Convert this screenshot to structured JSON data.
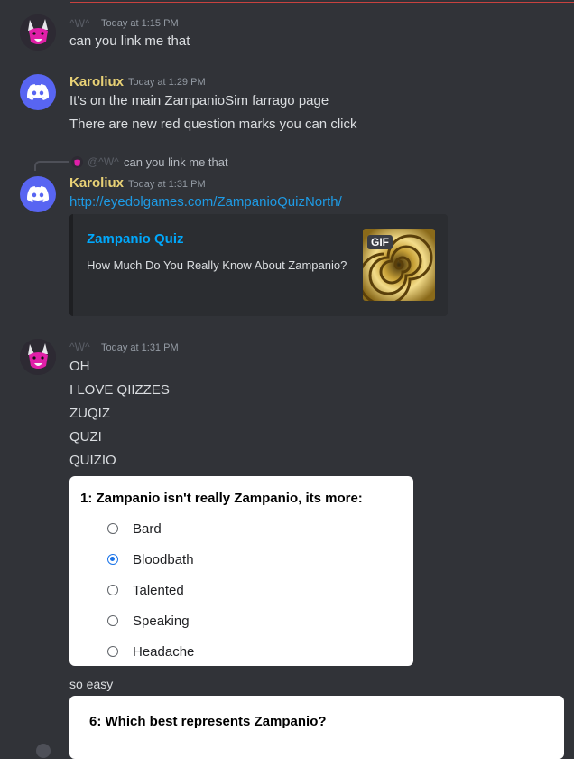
{
  "messages": [
    {
      "author": "^W^",
      "timestamp": "Today at 1:15 PM",
      "lines": [
        "can you link me that"
      ]
    },
    {
      "author": "Karoliux",
      "timestamp": "Today at 1:29 PM",
      "lines": [
        "It's on the main ZampanioSim farrago page",
        "There are new red question marks you can click"
      ]
    },
    {
      "reply": {
        "author": "@^W^",
        "text": "can you link me that"
      },
      "author": "Karoliux",
      "timestamp": "Today at 1:31 PM",
      "link": "http://eyedolgames.com/ZampanioQuizNorth/",
      "embed": {
        "title": "Zampanio Quiz",
        "description": "How Much Do You Really Know About Zampanio?",
        "badge": "GIF"
      }
    },
    {
      "author": "^W^",
      "timestamp": "Today at 1:31 PM",
      "lines": [
        "OH",
        "I LOVE QIIZZES",
        "ZUQIZ",
        "QUZI",
        "QUIZIO"
      ],
      "quiz": {
        "question": "1: Zampanio isn't really Zampanio, its more:",
        "options": [
          "Bard",
          "Bloodbath",
          "Talented",
          "Speaking",
          "Headache"
        ],
        "selected": "Bloodbath"
      },
      "after": "so easy",
      "quiz2": {
        "question": "6: Which best represents Zampanio?"
      }
    }
  ],
  "icons": {
    "discord": "discord-logo-icon",
    "fox": "fox-avatar-icon"
  },
  "colors": {
    "background": "#313338",
    "author_highlight": "#e8d176",
    "link": "#1e9be5",
    "embed_title": "#00a8fc",
    "radio_selected": "#1a73e8"
  }
}
